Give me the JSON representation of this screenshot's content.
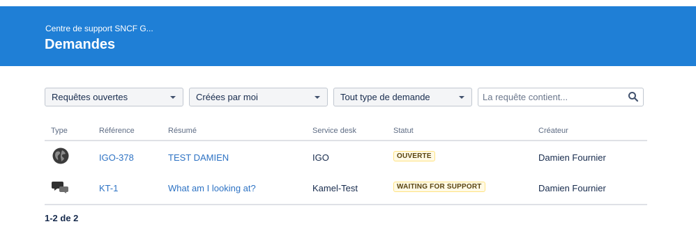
{
  "header": {
    "breadcrumb": "Centre de support SNCF G...",
    "title": "Demandes"
  },
  "filters": {
    "status": "Requêtes ouvertes",
    "owner": "Créées par moi",
    "type": "Tout type de demande",
    "search_placeholder": "La requête contient..."
  },
  "table": {
    "columns": [
      "Type",
      "Référence",
      "Résumé",
      "Service desk",
      "Statut",
      "Créateur"
    ],
    "rows": [
      {
        "type_icon": "globe-icon",
        "reference": "IGO-378",
        "summary": "TEST DAMIEN",
        "service_desk": "IGO",
        "status": "OUVERTE",
        "creator": "Damien Fournier"
      },
      {
        "type_icon": "chat-bubbles-icon",
        "reference": "KT-1",
        "summary": "What am I looking at?",
        "service_desk": "Kamel-Test",
        "status": "WAITING FOR SUPPORT",
        "creator": "Damien Fournier"
      }
    ]
  },
  "pagination": "1-2 de 2",
  "colors": {
    "header_bg": "#1f7fd6",
    "link": "#2e73c4",
    "lozenge_bg": "#fffae6"
  }
}
